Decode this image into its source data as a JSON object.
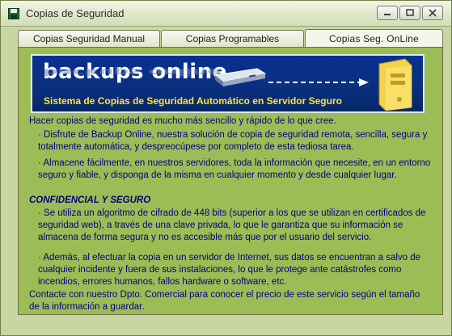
{
  "window": {
    "title": "Copias de Seguridad"
  },
  "tabs": [
    {
      "label": "Copias Seguridad Manual"
    },
    {
      "label": "Copias Programables"
    },
    {
      "label": "Copias Seg. OnLine"
    }
  ],
  "banner": {
    "logo": "backups online",
    "subtitle": "Sistema de Copias de Seguridad Automático en Servidor Seguro"
  },
  "content": {
    "intro": "Hacer copias de seguridad es mucho más sencillo y rápido de lo que cree.",
    "bullets_1": [
      "· Disfrute de Backup Online, nuestra solución de copia de seguridad remota, sencilla, segura y totalmente automática, y despreocúpese por completo de esta tediosa tarea.",
      "· Almacene fácilmente, en nuestros servidores, toda la información que necesite, en un entorno seguro y fiable, y disponga de la misma en cualquier momento y desde cualquier lugar."
    ],
    "heading": "CONFIDENCIAL Y SEGURO",
    "bullets_2": [
      "· Se utiliza un algoritmo de cifrado de 448 bits (superior a los que se utilizan en certificados de seguridad web), a través de una clave privada, lo que le garantiza que su información se almacena de forma segura y no es accesible más que por el usuario del servicio.",
      "· Además, al efectuar la copia en un servidor de Internet, sus datos se encuentran a salvo de cualquier incidente y fuera de sus instalaciones, lo que le protege ante catástrofes como incendios, errores humanos, fallos hardware o software, etc."
    ],
    "contact": "Contacte con nuestro Dpto. Comercial para conocer el precio de este servicio según el tamaño de la información a guardar."
  },
  "colors": {
    "panel": "#9cbd55",
    "text": "#00007f",
    "banner_bg": "#07318f",
    "banner_sub": "#ffe33a"
  }
}
